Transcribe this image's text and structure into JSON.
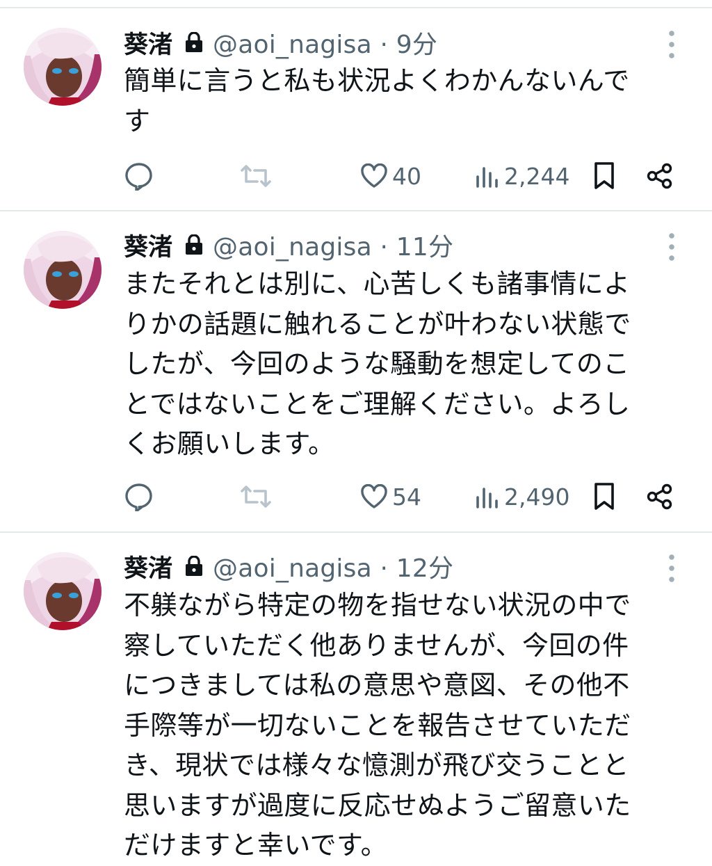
{
  "tweets": [
    {
      "name": "葵渚",
      "handle_time": "@aoi_nagisa · 9分",
      "text": "簡単に言うと私も状況よくわかんないんで\nす",
      "likes": "40",
      "views": "2,244"
    },
    {
      "name": "葵渚",
      "handle_time": "@aoi_nagisa · 11分",
      "text": "またそれとは別に、心苦しくも諸事情によ\nりかの話題に触れることが叶わない状態で\nしたが、今回のような騒動を想定してのこ\nとではないことをご理解ください。よろし\nくお願いします。",
      "likes": "54",
      "views": "2,490"
    },
    {
      "name": "葵渚",
      "handle_time": "@aoi_nagisa · 12分",
      "text": "不躾ながら特定の物を指せない状況の中で\n察していただく他ありませんが、今回の件\nにつきましては私の意思や意図、その他不\n手際等が一切ないことを報告させていただ\nき、現状では様々な憶測が飛び交うことと\n思いますが過度に反応せぬようご留意いた\nだけますと幸いです。"
    }
  ],
  "icons": {
    "lock": "lock-icon",
    "more": "more-icon",
    "reply": "reply-icon",
    "retweet": "retweet-icon",
    "like": "heart-icon",
    "views": "views-icon",
    "bookmark": "bookmark-icon",
    "share": "share-icon"
  },
  "colors": {
    "text": "#0f1419",
    "secondary": "#536471",
    "divider": "#e6e9ec",
    "retweet_muted": "#b9c3cc"
  }
}
